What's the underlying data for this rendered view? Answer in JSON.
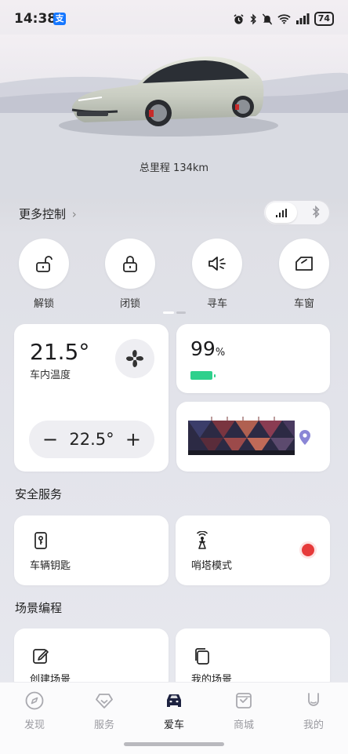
{
  "status": {
    "time": "14:38",
    "alipay_badge": "支",
    "battery": "74",
    "icons": [
      "alarm-icon",
      "bluetooth-icon",
      "mute-icon",
      "wifi-icon",
      "signal-icon",
      "battery-icon"
    ]
  },
  "vehicle": {
    "mileage_label": "总里程 134km"
  },
  "more_controls": {
    "label": "更多控制",
    "chevron": "›",
    "connection_mode": "cellular",
    "bluetooth_glyph": "✱"
  },
  "quick_controls": [
    {
      "label": "解锁",
      "icon": "unlock-icon"
    },
    {
      "label": "闭锁",
      "icon": "lock-icon"
    },
    {
      "label": "寻车",
      "icon": "find-car-icon"
    },
    {
      "label": "车窗",
      "icon": "window-icon"
    }
  ],
  "climate": {
    "inside_temp": "21.5°",
    "inside_label": "车内温度",
    "set_temp": "22.5°",
    "minus": "−",
    "plus": "+"
  },
  "battery_card": {
    "percent": "99",
    "unit": "%",
    "level": 0.99,
    "color": "#2fd08c"
  },
  "security": {
    "title": "安全服务",
    "items": [
      {
        "label": "车辆钥匙",
        "icon": "car-key-icon"
      },
      {
        "label": "哨塔模式",
        "icon": "sentry-tower-icon"
      }
    ],
    "sentry_indicator_color": "#e63a3a"
  },
  "scenes": {
    "title": "场景编程",
    "items": [
      {
        "label": "创建场景",
        "icon": "edit-icon"
      },
      {
        "label": "我的场景",
        "icon": "my-scenes-icon"
      }
    ]
  },
  "tabs": [
    {
      "label": "发现",
      "icon": "compass-icon",
      "active": false
    },
    {
      "label": "服务",
      "icon": "service-heart-icon",
      "active": false
    },
    {
      "label": "爱车",
      "icon": "car-icon",
      "active": true
    },
    {
      "label": "商城",
      "icon": "shop-icon",
      "active": false
    },
    {
      "label": "我的",
      "icon": "profile-icon",
      "active": false
    }
  ]
}
